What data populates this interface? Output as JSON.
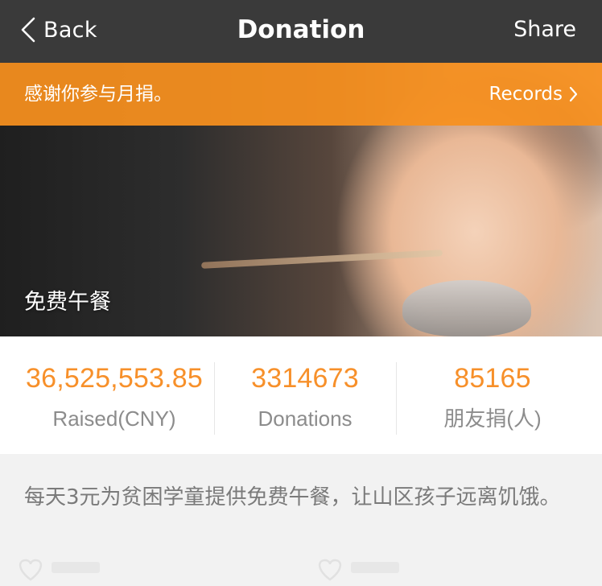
{
  "nav": {
    "back_label": "Back",
    "title": "Donation",
    "share_label": "Share"
  },
  "banner": {
    "text": "感谢你参与月捐。",
    "records_label": "Records"
  },
  "hero": {
    "title": "免费午餐"
  },
  "stats": [
    {
      "value": "36,525,553.85",
      "label": "Raised(CNY)"
    },
    {
      "value": "3314673",
      "label": "Donations"
    },
    {
      "value": "85165",
      "label": "朋友捐(人)"
    }
  ],
  "description": "每天3元为贫困学童提供免费午餐，让山区孩子远离饥饿。",
  "icons": {
    "back": "chevron-left-icon",
    "records": "chevron-right-icon",
    "watermark": "heart-logo-icon"
  },
  "colors": {
    "nav_bg": "#3a3a3a",
    "accent": "#f7902a",
    "banner_bg": "#f7901e",
    "label_gray": "#8c8c8c",
    "page_bg": "#f2f2f2"
  }
}
